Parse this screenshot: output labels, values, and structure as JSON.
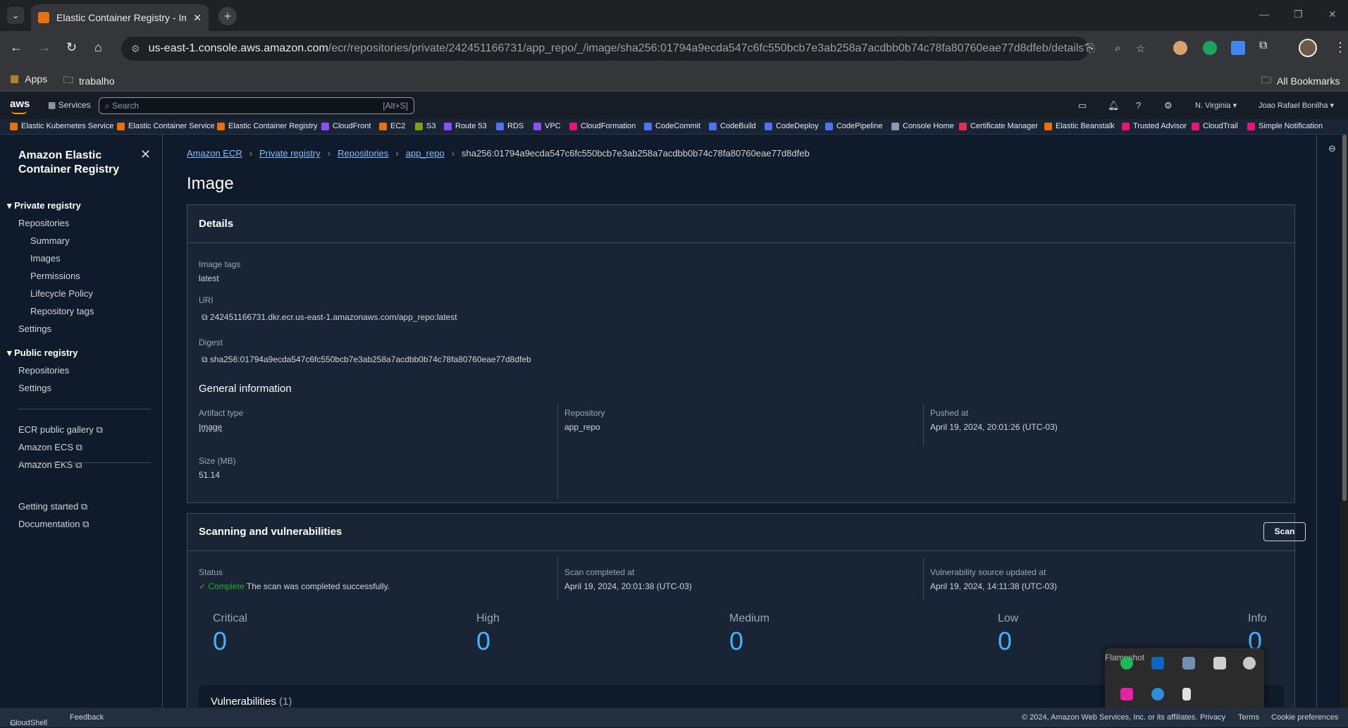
{
  "browser": {
    "tab_title": "Elastic Container Registry - Ima",
    "url_host": "us-east-1.console.aws.amazon.com",
    "url_path": "/ecr/repositories/private/242451166731/app_repo/_/image/sha256:01794a9ecda547c6fc550bcb7e3ab258a7acdbb0b74c78fa80760eae77d8dfeb/details?regio...",
    "bookmarks": [
      "Apps",
      "trabalho"
    ],
    "all_bookmarks": "All Bookmarks"
  },
  "aws_header": {
    "logo": "aws",
    "services": "Services",
    "search_placeholder": "Search",
    "search_shortcut": "[Alt+S]",
    "region": "N. Virginia ▾",
    "user": "Joao Rafael Bonilha ▾"
  },
  "favorites": [
    {
      "label": "Elastic Kubernetes Service",
      "color": "#ed7100"
    },
    {
      "label": "Elastic Container Service",
      "color": "#ed7100"
    },
    {
      "label": "Elastic Container Registry",
      "color": "#ed7100"
    },
    {
      "label": "CloudFront",
      "color": "#8c4fff"
    },
    {
      "label": "EC2",
      "color": "#ed7100"
    },
    {
      "label": "S3",
      "color": "#7aa116"
    },
    {
      "label": "Route 53",
      "color": "#8c4fff"
    },
    {
      "label": "RDS",
      "color": "#4d72f3"
    },
    {
      "label": "VPC",
      "color": "#8c4fff"
    },
    {
      "label": "CloudFormation",
      "color": "#e7157b"
    },
    {
      "label": "CodeCommit",
      "color": "#4d72f3"
    },
    {
      "label": "CodeBuild",
      "color": "#4d72f3"
    },
    {
      "label": "CodeDeploy",
      "color": "#4d72f3"
    },
    {
      "label": "CodePipeline",
      "color": "#4d72f3"
    },
    {
      "label": "Console Home",
      "color": "#8d99a8"
    },
    {
      "label": "Certificate Manager",
      "color": "#dd344c"
    },
    {
      "label": "Elastic Beanstalk",
      "color": "#ed7100"
    },
    {
      "label": "Trusted Advisor",
      "color": "#e7157b"
    },
    {
      "label": "CloudTrail",
      "color": "#e7157b"
    },
    {
      "label": "Simple Notification",
      "color": "#e7157b"
    }
  ],
  "sidebar": {
    "title": "Amazon Elastic Container Registry",
    "private_registry": "Private registry",
    "private_items": [
      "Repositories",
      "Summary",
      "Images",
      "Permissions",
      "Lifecycle Policy",
      "Repository tags",
      "Settings"
    ],
    "public_registry": "Public registry",
    "public_items": [
      "Repositories",
      "Settings"
    ],
    "links": [
      "ECR public gallery",
      "Amazon ECS",
      "Amazon EKS"
    ],
    "help_links": [
      "Getting started",
      "Documentation"
    ]
  },
  "breadcrumb": [
    "Amazon ECR",
    "Private registry",
    "Repositories",
    "app_repo",
    "sha256:01794a9ecda547c6fc550bcb7e3ab258a7acdbb0b74c78fa80760eae77d8dfeb"
  ],
  "page_title": "Image",
  "details": {
    "heading": "Details",
    "image_tags_label": "Image tags",
    "image_tags": "latest",
    "uri_label": "URI",
    "uri": "242451166731.dkr.ecr.us-east-1.amazonaws.com/app_repo:latest",
    "digest_label": "Digest",
    "digest": "sha256:01794a9ecda547c6fc550bcb7e3ab258a7acdbb0b74c78fa80760eae77d8dfeb",
    "general_heading": "General information",
    "artifact_type_label": "Artifact type",
    "artifact_type": "Image",
    "repository_label": "Repository",
    "repository": "app_repo",
    "pushed_at_label": "Pushed at",
    "pushed_at": "April 19, 2024, 20:01:26 (UTC-03)",
    "size_label": "Size (MB)",
    "size": "51.14"
  },
  "scanning": {
    "heading": "Scanning and vulnerabilities",
    "scan_button": "Scan",
    "status_label": "Status",
    "status_value": "Complete",
    "status_text": "The scan was completed successfully.",
    "scan_completed_label": "Scan completed at",
    "scan_completed": "April 19, 2024, 20:01:38 (UTC-03)",
    "vuln_source_label": "Vulnerability source updated at",
    "vuln_source": "April 19, 2024, 14:11:38 (UTC-03)",
    "counts": [
      {
        "label": "Critical",
        "value": "0"
      },
      {
        "label": "High",
        "value": "0"
      },
      {
        "label": "Medium",
        "value": "0"
      },
      {
        "label": "Low",
        "value": "0"
      },
      {
        "label": "Info",
        "value": "0"
      }
    ],
    "vulnerabilities_title": "Vulnerabilities",
    "vulnerabilities_count": "(1)"
  },
  "tray": {
    "tooltip": "Flameshot"
  },
  "footer": {
    "cloudshell": "CloudShell",
    "feedback": "Feedback",
    "copyright": "© 2024, Amazon Web Services, Inc. or its affiliates.",
    "privacy": "Privacy",
    "terms": "Terms",
    "cookies": "Cookie preferences"
  }
}
